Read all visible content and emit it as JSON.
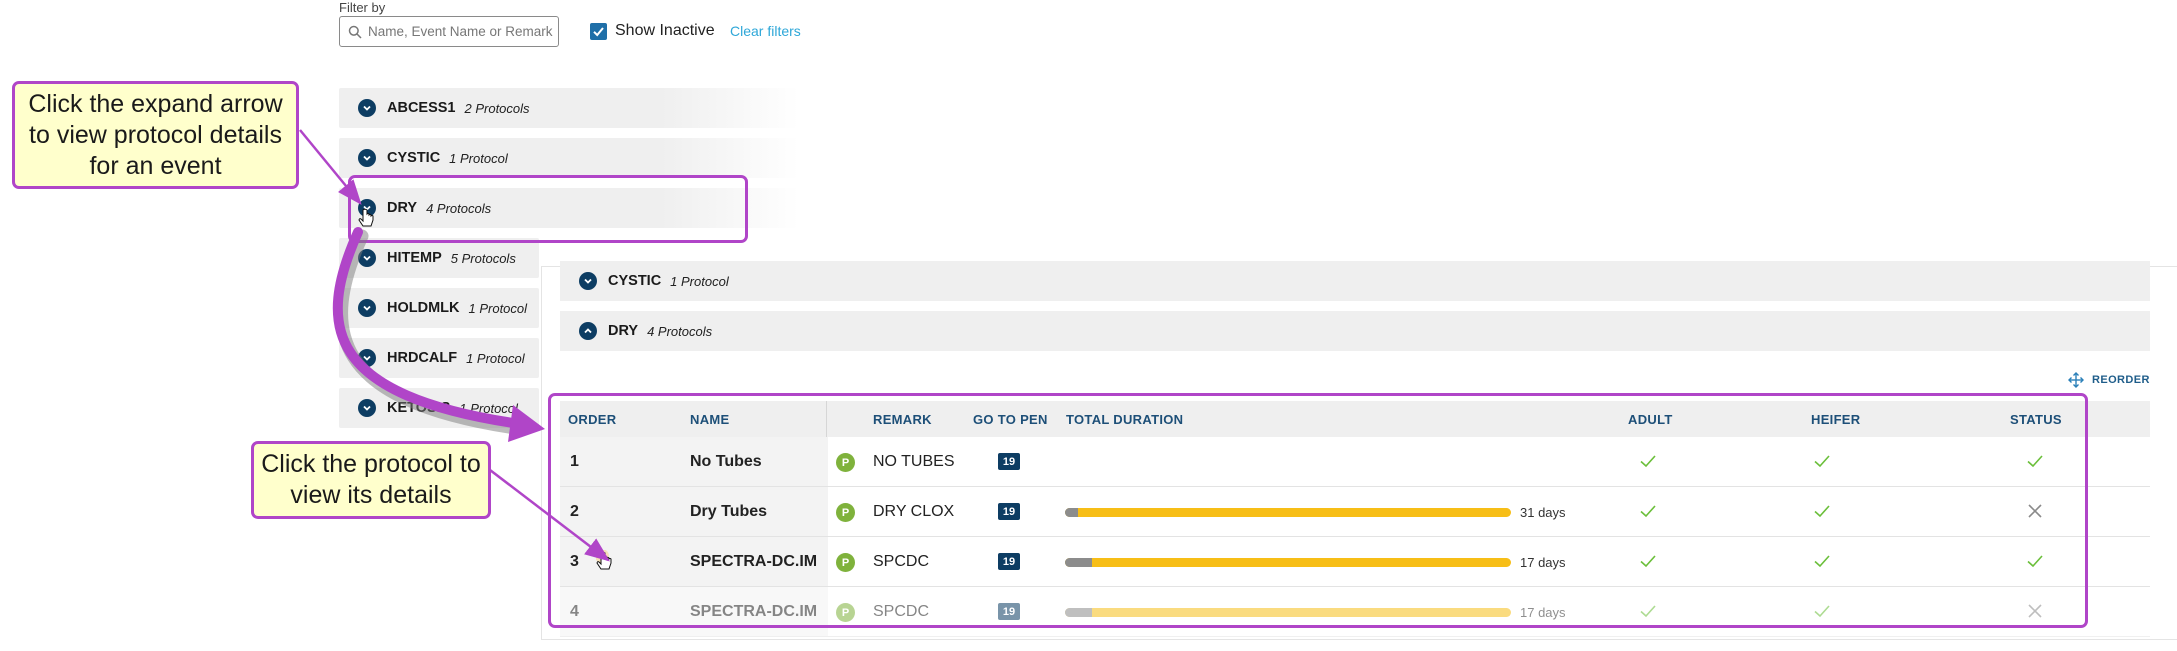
{
  "filter": {
    "label": "Filter by",
    "search_placeholder": "Name, Event Name or Remark",
    "show_inactive_label": "Show Inactive",
    "show_inactive_checked": true,
    "clear_filters_label": "Clear filters"
  },
  "events": [
    {
      "name": "ABCESS1",
      "count": "2 Protocols"
    },
    {
      "name": "CYSTIC",
      "count": "1 Protocol"
    },
    {
      "name": "DRY",
      "count": "4 Protocols"
    },
    {
      "name": "HITEMP",
      "count": "5 Protocols"
    },
    {
      "name": "HOLDMLK",
      "count": "1 Protocol"
    },
    {
      "name": "HRDCALF",
      "count": "1 Protocol"
    },
    {
      "name": "KETOSIS",
      "count": "1 Protocol"
    }
  ],
  "panel": {
    "events": [
      {
        "name": "CYSTIC",
        "count": "1 Protocol",
        "expanded": false
      },
      {
        "name": "DRY",
        "count": "4 Protocols",
        "expanded": true
      }
    ],
    "reorder_label": "REORDER",
    "table": {
      "headers": {
        "order": "ORDER",
        "name": "NAME",
        "remark": "REMARK",
        "go_to_pen": "GO TO PEN",
        "total_duration": "TOTAL DURATION",
        "adult": "ADULT",
        "heifer": "HEIFER",
        "status": "STATUS"
      },
      "rows": [
        {
          "order": "1",
          "name": "No Tubes",
          "badge": "P",
          "remark": "NO TUBES",
          "pen": "19",
          "duration_days": "",
          "duration_fraction": 0,
          "grey_fraction": 0,
          "adult": "check",
          "heifer": "check",
          "status": "check"
        },
        {
          "order": "2",
          "name": "Dry Tubes",
          "badge": "P",
          "remark": "DRY CLOX",
          "pen": "19",
          "duration_days": "31 days",
          "duration_fraction": 1,
          "grey_fraction": 0.03,
          "adult": "check",
          "heifer": "check",
          "status": "x"
        },
        {
          "order": "3",
          "name": "SPECTRA-DC.IM",
          "badge": "P",
          "remark": "SPCDC",
          "pen": "19",
          "duration_days": "17 days",
          "duration_fraction": 1,
          "grey_fraction": 0.06,
          "adult": "check",
          "heifer": "check",
          "status": "check"
        },
        {
          "order": "4",
          "name": "SPECTRA-DC.IM",
          "badge": "P",
          "remark": "SPCDC",
          "pen": "19",
          "duration_days": "17 days",
          "duration_fraction": 1,
          "grey_fraction": 0.06,
          "adult": "check",
          "heifer": "check",
          "status": "x"
        }
      ]
    }
  },
  "callouts": {
    "expand": "Click the expand arrow to view protocol details for an event",
    "protocol": "Click the protocol to view its details"
  },
  "colors": {
    "accent": "#b045c8",
    "navy": "#0d3d63",
    "bar_gold": "#f7be17",
    "badge_green": "#7fb23c",
    "link": "#2ea7d8",
    "check_green": "#6bbf3a"
  }
}
